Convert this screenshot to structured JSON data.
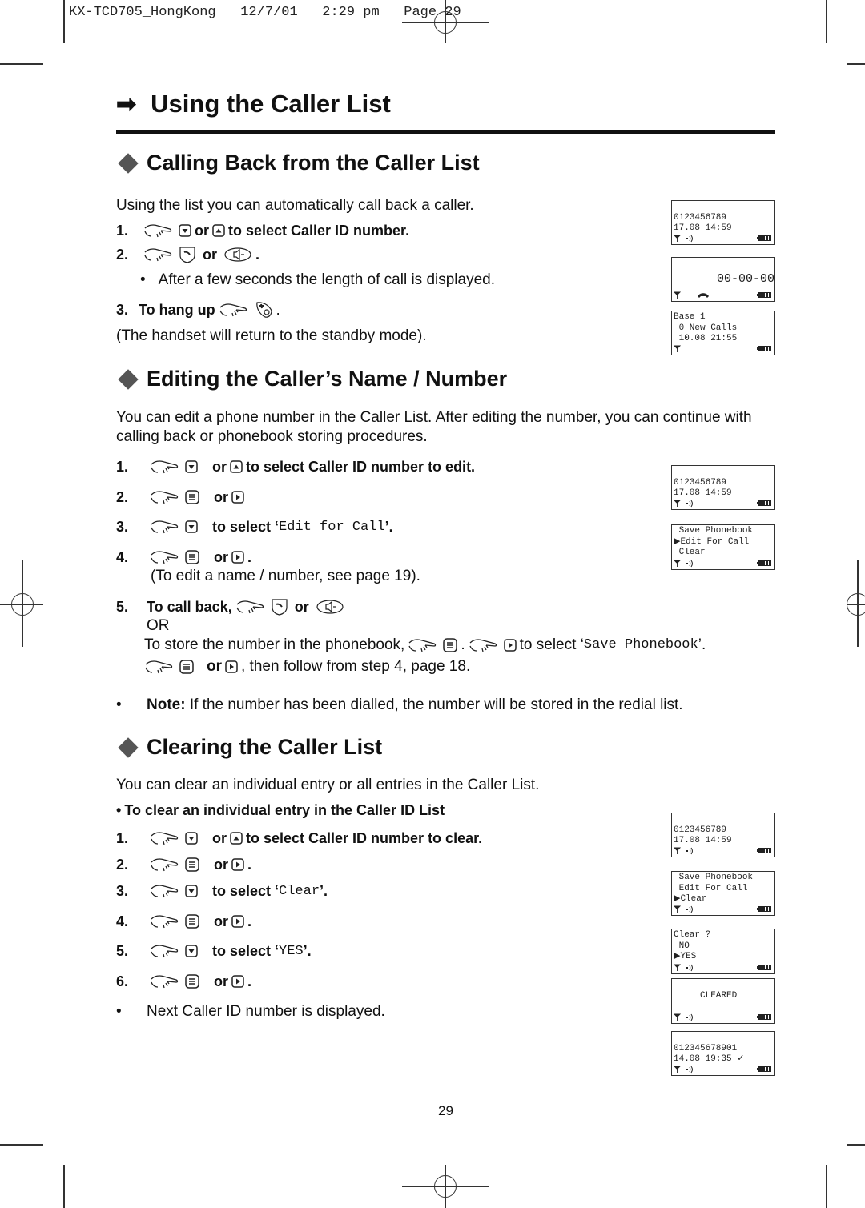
{
  "print_slug": "KX-TCD705_HongKong   12/7/01   2:29 pm   Page 29",
  "title": "Using the Caller List",
  "title_icon": "right-arrow-icon",
  "sections": {
    "callback": {
      "heading": "Calling Back from the Caller List",
      "intro": "Using the list you can automatically call back a caller.",
      "step1": {
        "num": "1.",
        "or": "or",
        "text": "to select Caller ID number."
      },
      "step2": {
        "num": "2.",
        "or": "or",
        "end": "."
      },
      "step2_note": "After a few seconds the length of call is displayed.",
      "step3": {
        "num": "3.",
        "text": "To hang up",
        "end": "."
      },
      "step3_note": "(The handset will return to the standby mode)."
    },
    "editing": {
      "heading": "Editing the Caller’s Name /  Number",
      "intro": "You can edit a phone number in the Caller List. After editing the number, you can continue with calling back or phonebook storing procedures.",
      "step1": {
        "num": "1.",
        "or": "or",
        "text": "to select Caller ID number to edit."
      },
      "step2": {
        "num": "2.",
        "or": "or"
      },
      "step3": {
        "num": "3.",
        "text": "to select ‘",
        "mono": "Edit for Call",
        "end": "’."
      },
      "step4": {
        "num": "4.",
        "or": "or",
        "end": "."
      },
      "step4_note": "(To edit a name / number, see page 19).",
      "step5": {
        "num": "5.",
        "text": "To call back,",
        "or": "or"
      },
      "step5_or": "OR",
      "step5_store": {
        "pre": "To store the number in the phonebook,",
        "mid": ".",
        "post": "to select ‘",
        "mono": "Save Phonebook",
        "end": "’."
      },
      "step5_follow": {
        "or": "or",
        "post": ", then follow from step 4, page 18."
      },
      "note_label": "Note:",
      "note_text": " If the number has been dialled, the number will be stored in the redial list."
    },
    "clearing": {
      "heading": "Clearing the Caller List",
      "intro": "You can clear an individual entry or all entries in the Caller List.",
      "subheading": "To clear an individual entry in the Caller ID List",
      "step1": {
        "num": "1.",
        "or": "or",
        "text": "to select Caller ID number to clear."
      },
      "step2": {
        "num": "2.",
        "or": "or",
        "end": "."
      },
      "step3": {
        "num": "3.",
        "text": "to select ‘",
        "mono": "Clear",
        "end": "’."
      },
      "step4": {
        "num": "4.",
        "or": "or",
        "end": "."
      },
      "step5": {
        "num": "5.",
        "text": "to select ‘",
        "mono": "YES",
        "end": "’."
      },
      "step6": {
        "num": "6.",
        "or": "or",
        "end": "."
      },
      "final_note": "Next Caller ID number is displayed."
    }
  },
  "displays": [
    {
      "lines": [
        "",
        "0123456789",
        "17.08 14:59"
      ],
      "ringer": true
    },
    {
      "lines": [
        "",
        "",
        "      00-00-00"
      ],
      "ringer": false,
      "handset": true
    },
    {
      "lines": [
        "Base 1",
        " 0 New Calls",
        " 10.08 21:55"
      ],
      "ringer": false
    },
    {
      "lines": [
        "",
        "0123456789",
        "17.08 14:59"
      ],
      "ringer": true
    },
    {
      "lines": [
        " Save Phonebook",
        "▶Edit For Call",
        " Clear"
      ],
      "ringer": true
    },
    {
      "lines": [
        "",
        "0123456789",
        "17.08 14:59"
      ],
      "ringer": true
    },
    {
      "lines": [
        " Save Phonebook",
        " Edit For Call",
        "▶Clear"
      ],
      "ringer": true
    },
    {
      "lines": [
        "Clear ?",
        " NO",
        "▶YES"
      ],
      "ringer": true
    },
    {
      "lines": [
        "",
        "     CLEARED",
        ""
      ],
      "ringer": true
    },
    {
      "lines": [
        "",
        "012345678901",
        "14.08 19:35 ✓"
      ],
      "ringer": true
    }
  ],
  "page_number": "29"
}
